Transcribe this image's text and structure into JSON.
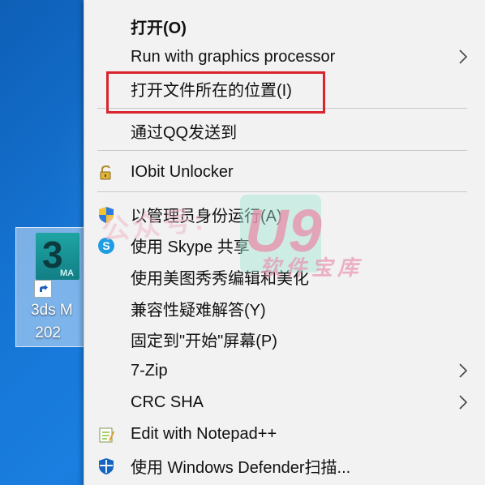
{
  "desktop_icon": {
    "label": "3ds M\n 202",
    "tile_text": "3",
    "tile_sub": "MA"
  },
  "menu": {
    "items": [
      {
        "label": "打开(O)",
        "bold": true
      },
      {
        "label": "Run with graphics processor",
        "has_submenu": true
      },
      {
        "label": "打开文件所在的位置(I)"
      },
      {
        "label": "通过QQ发送到"
      },
      {
        "label": "IObit Unlocker",
        "icon": "lock-icon"
      },
      {
        "label": "以管理员身份运行(A)",
        "icon": "uac-shield-icon"
      },
      {
        "label": "使用 Skype 共享",
        "icon": "skype-icon"
      },
      {
        "label": "使用美图秀秀编辑和美化"
      },
      {
        "label": "兼容性疑难解答(Y)"
      },
      {
        "label": "固定到\"开始\"屏幕(P)"
      },
      {
        "label": "7-Zip",
        "has_submenu": true
      },
      {
        "label": "CRC SHA",
        "has_submenu": true
      },
      {
        "label": "Edit with Notepad++",
        "icon": "notepadpp-icon"
      },
      {
        "label": "使用 Windows Defender扫描...",
        "icon": "defender-icon"
      }
    ]
  },
  "watermark": {
    "text": "公众号:",
    "brand": "U9",
    "sub": "软件宝库"
  },
  "colors": {
    "highlight_box": "#d9232d",
    "menu_bg": "#f2f2f2",
    "desktop_bg": "#1676d6"
  }
}
